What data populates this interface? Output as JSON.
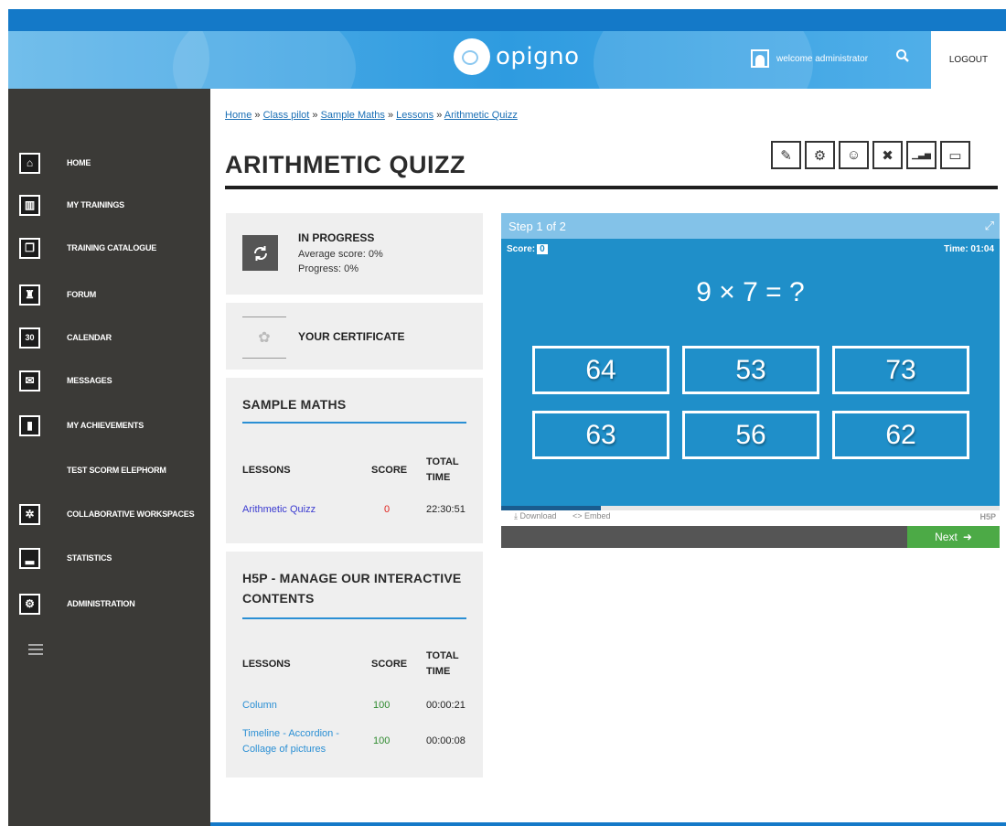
{
  "header": {
    "logo_text": "opigno",
    "welcome": "welcome administrator",
    "logout": "LOGOUT",
    "search_icon": "search-icon"
  },
  "sidebar": {
    "items": [
      {
        "label": "HOME",
        "icon": "home-icon",
        "glyph": "⌂"
      },
      {
        "label": "MY TRAININGS",
        "icon": "books-icon",
        "glyph": "▥"
      },
      {
        "label": "TRAINING CATALOGUE",
        "icon": "catalogue-icon",
        "glyph": "❐"
      },
      {
        "label": "FORUM",
        "icon": "forum-icon",
        "glyph": "♜"
      },
      {
        "label": "CALENDAR",
        "icon": "calendar-icon",
        "glyph": "30"
      },
      {
        "label": "MESSAGES",
        "icon": "messages-icon",
        "glyph": "✉"
      },
      {
        "label": "MY ACHIEVEMENTS",
        "icon": "bookmark-icon",
        "glyph": "▮"
      },
      {
        "label": "TEST SCORM ELEPHORM",
        "icon": "",
        "glyph": ""
      },
      {
        "label": "COLLABORATIVE WORKSPACES",
        "icon": "network-icon",
        "glyph": "✲"
      },
      {
        "label": "STATISTICS",
        "icon": "statistics-icon",
        "glyph": "▂"
      },
      {
        "label": "ADMINISTRATION",
        "icon": "gears-icon",
        "glyph": "⚙"
      }
    ]
  },
  "breadcrumb": {
    "items": [
      "Home",
      "Class pilot",
      "Sample Maths",
      "Lessons",
      "Arithmetic Quizz"
    ],
    "separator": "»"
  },
  "page_title": "ARITHMETIC QUIZZ",
  "tools": [
    {
      "icon": "edit-icon",
      "glyph": "✎"
    },
    {
      "icon": "settings-icon",
      "glyph": "⚙"
    },
    {
      "icon": "members-icon",
      "glyph": "☺"
    },
    {
      "icon": "tools-icon",
      "glyph": "✖"
    },
    {
      "icon": "chart-icon",
      "glyph": "▁▃▅"
    },
    {
      "icon": "scoreboard-icon",
      "glyph": "▭"
    }
  ],
  "status": {
    "title": "IN PROGRESS",
    "average_score": "Average score: 0%",
    "progress": "Progress: 0%"
  },
  "certificate": {
    "title": "YOUR CERTIFICATE"
  },
  "sections": [
    {
      "title": "SAMPLE MATHS",
      "headers": {
        "lessons": "LESSONS",
        "score": "SCORE",
        "total": "TOTAL",
        "time": "TIME"
      },
      "rows": [
        {
          "lesson": "Arithmetic Quizz",
          "score": "0",
          "time": "22:30:51"
        }
      ]
    },
    {
      "title_line1": "H5P - MANAGE OUR INTERACTIVE",
      "title_line2": "CONTENTS",
      "headers": {
        "lessons": "LESSONS",
        "score": "SCORE",
        "total": "TOTAL",
        "time": "TIME"
      },
      "rows": [
        {
          "lesson": "Column",
          "score": "100",
          "time": "00:00:21"
        },
        {
          "lesson_line1": "Timeline - Accordion -",
          "lesson_line2": "Collage of pictures",
          "score": "100",
          "time": "00:00:08"
        }
      ]
    }
  ],
  "player": {
    "step": "Step 1 of 2",
    "score_label": "Score:",
    "score_value": "0",
    "time_label": "Time: 01:04",
    "question": "9 × 7 = ?",
    "answers": [
      "64",
      "53",
      "73",
      "63",
      "56",
      "62"
    ],
    "progress_fraction": 0.2,
    "download": "Download",
    "embed": "Embed",
    "h5p_label": "H5P",
    "next": "Next"
  }
}
